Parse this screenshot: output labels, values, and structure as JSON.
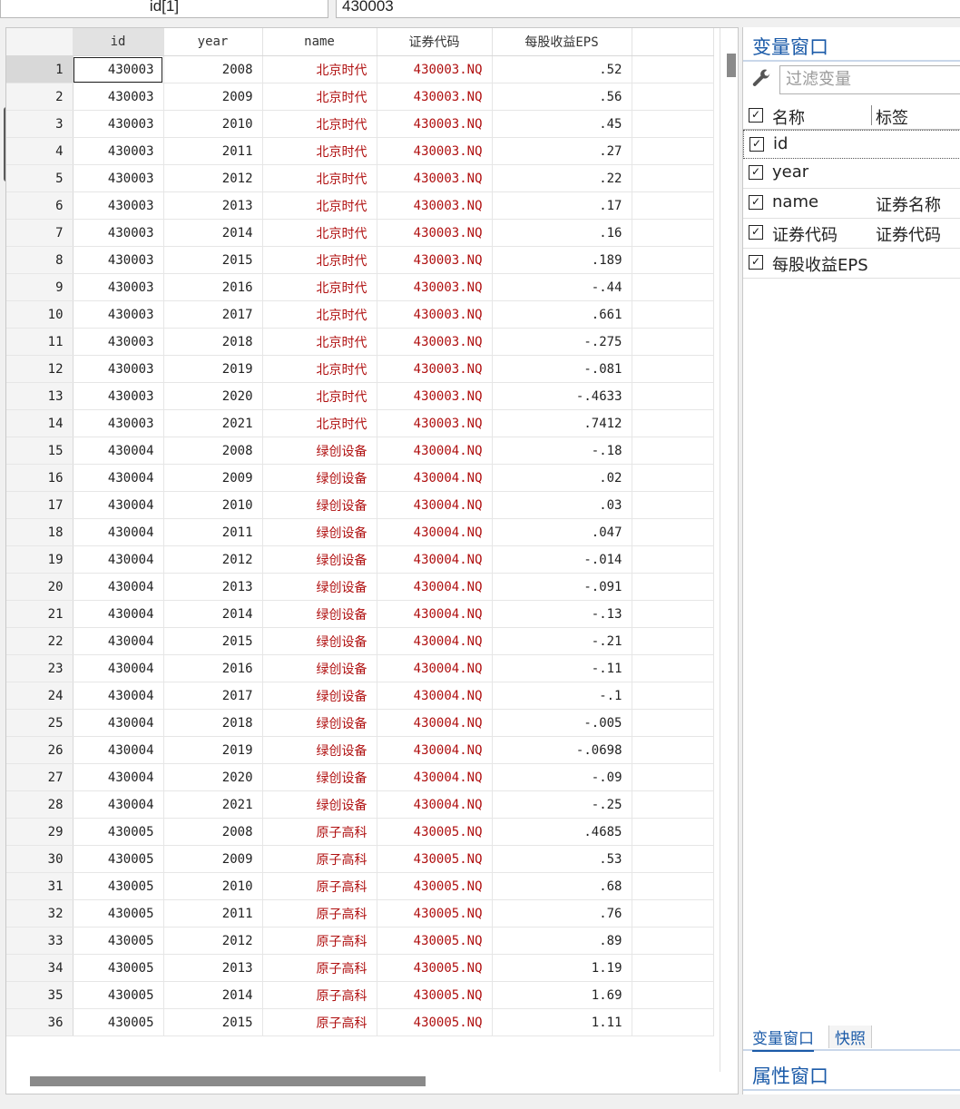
{
  "editbar": {
    "cell_ref": "id[1]",
    "cell_value": "430003"
  },
  "grid": {
    "columns": [
      "id",
      "year",
      "name",
      "证券代码",
      "每股收益EPS"
    ],
    "rows": [
      [
        "1",
        "430003",
        "2008",
        "北京时代",
        "430003.NQ",
        ".52"
      ],
      [
        "2",
        "430003",
        "2009",
        "北京时代",
        "430003.NQ",
        ".56"
      ],
      [
        "3",
        "430003",
        "2010",
        "北京时代",
        "430003.NQ",
        ".45"
      ],
      [
        "4",
        "430003",
        "2011",
        "北京时代",
        "430003.NQ",
        ".27"
      ],
      [
        "5",
        "430003",
        "2012",
        "北京时代",
        "430003.NQ",
        ".22"
      ],
      [
        "6",
        "430003",
        "2013",
        "北京时代",
        "430003.NQ",
        ".17"
      ],
      [
        "7",
        "430003",
        "2014",
        "北京时代",
        "430003.NQ",
        ".16"
      ],
      [
        "8",
        "430003",
        "2015",
        "北京时代",
        "430003.NQ",
        ".189"
      ],
      [
        "9",
        "430003",
        "2016",
        "北京时代",
        "430003.NQ",
        "-.44"
      ],
      [
        "10",
        "430003",
        "2017",
        "北京时代",
        "430003.NQ",
        ".661"
      ],
      [
        "11",
        "430003",
        "2018",
        "北京时代",
        "430003.NQ",
        "-.275"
      ],
      [
        "12",
        "430003",
        "2019",
        "北京时代",
        "430003.NQ",
        "-.081"
      ],
      [
        "13",
        "430003",
        "2020",
        "北京时代",
        "430003.NQ",
        "-.4633"
      ],
      [
        "14",
        "430003",
        "2021",
        "北京时代",
        "430003.NQ",
        ".7412"
      ],
      [
        "15",
        "430004",
        "2008",
        "绿创设备",
        "430004.NQ",
        "-.18"
      ],
      [
        "16",
        "430004",
        "2009",
        "绿创设备",
        "430004.NQ",
        ".02"
      ],
      [
        "17",
        "430004",
        "2010",
        "绿创设备",
        "430004.NQ",
        ".03"
      ],
      [
        "18",
        "430004",
        "2011",
        "绿创设备",
        "430004.NQ",
        ".047"
      ],
      [
        "19",
        "430004",
        "2012",
        "绿创设备",
        "430004.NQ",
        "-.014"
      ],
      [
        "20",
        "430004",
        "2013",
        "绿创设备",
        "430004.NQ",
        "-.091"
      ],
      [
        "21",
        "430004",
        "2014",
        "绿创设备",
        "430004.NQ",
        "-.13"
      ],
      [
        "22",
        "430004",
        "2015",
        "绿创设备",
        "430004.NQ",
        "-.21"
      ],
      [
        "23",
        "430004",
        "2016",
        "绿创设备",
        "430004.NQ",
        "-.11"
      ],
      [
        "24",
        "430004",
        "2017",
        "绿创设备",
        "430004.NQ",
        "-.1"
      ],
      [
        "25",
        "430004",
        "2018",
        "绿创设备",
        "430004.NQ",
        "-.005"
      ],
      [
        "26",
        "430004",
        "2019",
        "绿创设备",
        "430004.NQ",
        "-.0698"
      ],
      [
        "27",
        "430004",
        "2020",
        "绿创设备",
        "430004.NQ",
        "-.09"
      ],
      [
        "28",
        "430004",
        "2021",
        "绿创设备",
        "430004.NQ",
        "-.25"
      ],
      [
        "29",
        "430005",
        "2008",
        "原子高科",
        "430005.NQ",
        ".4685"
      ],
      [
        "30",
        "430005",
        "2009",
        "原子高科",
        "430005.NQ",
        ".53"
      ],
      [
        "31",
        "430005",
        "2010",
        "原子高科",
        "430005.NQ",
        ".68"
      ],
      [
        "32",
        "430005",
        "2011",
        "原子高科",
        "430005.NQ",
        ".76"
      ],
      [
        "33",
        "430005",
        "2012",
        "原子高科",
        "430005.NQ",
        ".89"
      ],
      [
        "34",
        "430005",
        "2013",
        "原子高科",
        "430005.NQ",
        "1.19"
      ],
      [
        "35",
        "430005",
        "2014",
        "原子高科",
        "430005.NQ",
        "1.69"
      ],
      [
        "36",
        "430005",
        "2015",
        "原子高科",
        "430005.NQ",
        "1.11"
      ]
    ]
  },
  "variables_panel": {
    "title": "变量窗口",
    "filter_placeholder": "过滤变量",
    "header": {
      "name": "名称",
      "label": "标签"
    },
    "items": [
      {
        "name": "id",
        "label": ""
      },
      {
        "name": "year",
        "label": ""
      },
      {
        "name": "name",
        "label": "证券名称"
      },
      {
        "name": "证券代码",
        "label": "证券代码"
      },
      {
        "name": "每股收益EPS",
        "label": ""
      }
    ],
    "tabs": [
      "变量窗口",
      "快照"
    ],
    "properties_title": "属性窗口"
  },
  "colors": {
    "string_text": "#b01010",
    "panel_accent": "#1a5aa8"
  },
  "icons": {
    "filter": "wrench-icon",
    "checkbox": "checkbox-checked-icon"
  }
}
